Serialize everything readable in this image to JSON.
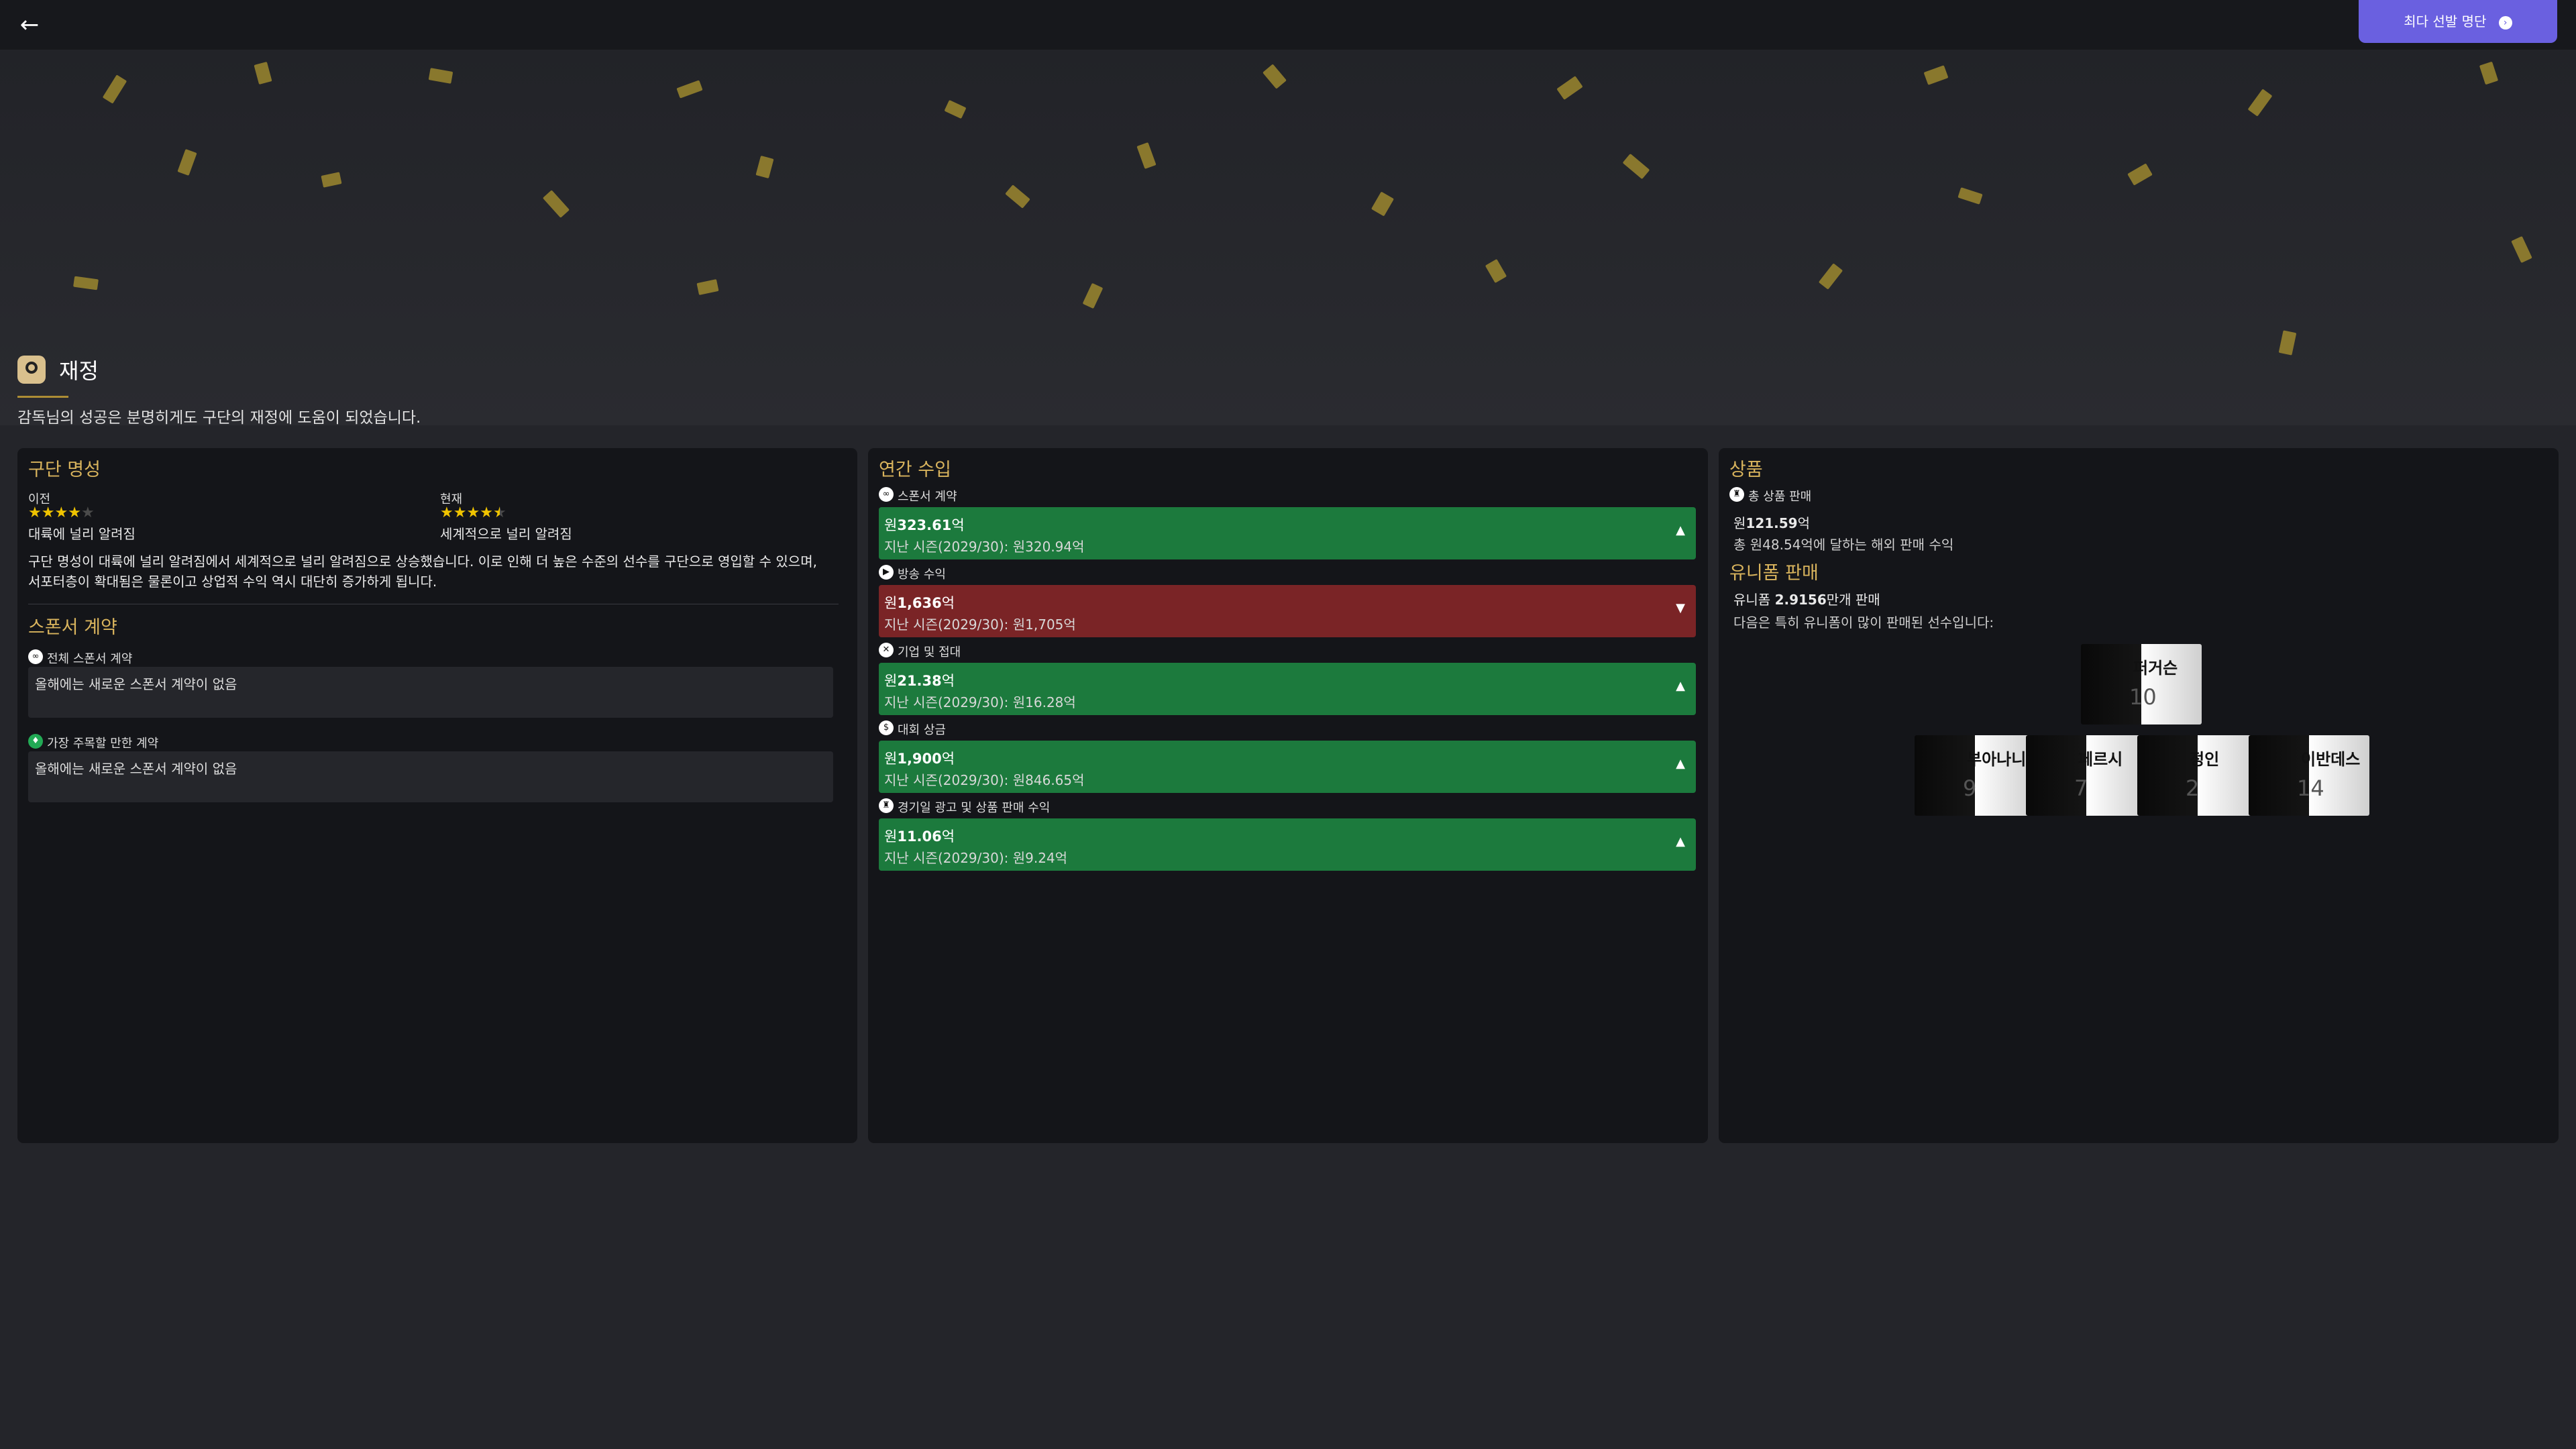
{
  "topbar": {
    "back_icon": "arrow-left-icon",
    "cta_label": "최다 선발 명단",
    "cta_icon": "arrow-right-circle-icon"
  },
  "header": {
    "title": "재정",
    "subtitle": "감독님의 성공은 분명히게도 구단의 재정에 도움이 되었습니다."
  },
  "club_reputation": {
    "title": "구단 명성",
    "previous": {
      "label": "이전",
      "stars": 4,
      "text": "대륙에 널리 알려짐"
    },
    "current": {
      "label": "현재",
      "stars": 4.5,
      "text": "세계적으로 널리 알려짐"
    },
    "description": "구단 명성이 대륙에 널리 알려짐에서 세계적으로 널리 알려짐으로 상승했습니다. 이로 인해 더 높은 수준의 선수를 구단으로 영입할 수 있으며, 서포터층이 확대됨은 물론이고 상업적 수익 역시 대단히 증가하게 됩니다."
  },
  "sponsor": {
    "title": "스폰서 계약",
    "total_label": "전체 스폰서 계약",
    "total_value": "올해에는 새로운 스폰서 계약이 없음",
    "notable_label": "가장 주목할 만한 계약",
    "notable_value": "올해에는 새로운 스폰서 계약이 없음"
  },
  "annual_income": {
    "title": "연간 수입",
    "items": [
      {
        "label": "스폰서 계약",
        "value_prefix": "원",
        "value_num": "323.61",
        "value_unit": "억",
        "prev": "지난 시즌(2029/30): 원320.94억",
        "trend": "up",
        "color": "#1c7a3d"
      },
      {
        "label": "방송 수익",
        "value_prefix": "원",
        "value_num": "1,636",
        "value_unit": "억",
        "prev": "지난 시즌(2029/30): 원1,705억",
        "trend": "down",
        "color": "#7a2426"
      },
      {
        "label": "기업 및 접대",
        "value_prefix": "원",
        "value_num": "21.38",
        "value_unit": "억",
        "prev": "지난 시즌(2029/30): 원16.28억",
        "trend": "up",
        "color": "#1c7a3d"
      },
      {
        "label": "대회 상금",
        "value_prefix": "원",
        "value_num": "1,900",
        "value_unit": "억",
        "prev": "지난 시즌(2029/30): 원846.65억",
        "trend": "up",
        "color": "#1c7a3d"
      },
      {
        "label": "경기일 광고 및 상품 판매 수익",
        "value_prefix": "원",
        "value_num": "11.06",
        "value_unit": "억",
        "prev": "지난 시즌(2029/30): 원9.24억",
        "trend": "up",
        "color": "#1c7a3d"
      }
    ]
  },
  "merch": {
    "title": "상품",
    "total_label": "총 상품 판매",
    "total_prefix": "원",
    "total_num": "121.59",
    "total_unit": "억",
    "total_desc": "총 원48.54억에 달하는 해외 판매 수익",
    "uniform_title": "유니폼 판매",
    "uniform_prefix": "유니폼 ",
    "uniform_num": "2.9156",
    "uniform_suffix": "만개 판매",
    "uniform_desc": "다음은 특히 유니폼이 많이 판매된 선수입니다:"
  },
  "jerseys": [
    {
      "name": "퍼거슨",
      "number": "10"
    },
    {
      "name": "부아나니",
      "number": "9"
    },
    {
      "name": "페르시",
      "number": "7"
    },
    {
      "name": "정인",
      "number": "2"
    },
    {
      "name": "이반데스",
      "number": "14"
    }
  ],
  "colors": {
    "accent": "#6a60e0",
    "gold": "#d9b45d",
    "positive": "#1c7a3d",
    "negative": "#7a2426",
    "star": "#f0c400"
  }
}
